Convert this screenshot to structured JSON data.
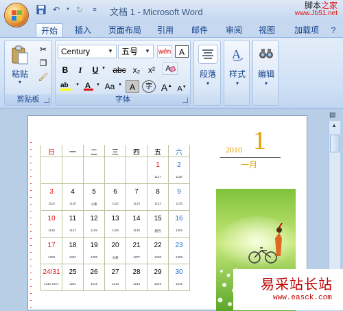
{
  "window": {
    "title": "文档 1 - Microsoft Word"
  },
  "brand": {
    "line1_a": "脚本",
    "line1_b": "之家",
    "line2": "www.Jb51.net"
  },
  "tabs": [
    "开始",
    "插入",
    "页面布局",
    "引用",
    "邮件",
    "审阅",
    "视图",
    "加载项"
  ],
  "active_tab": "开始",
  "ribbon": {
    "clipboard": {
      "paste_label": "粘贴",
      "group_label": "剪贴板"
    },
    "font": {
      "font_name": "Century",
      "font_size": "五号",
      "group_label": "字体",
      "wen": "wén",
      "A": "A",
      "B": "B",
      "I": "I",
      "U": "U",
      "abc": "abc",
      "sub": "x₂",
      "sup": "x²",
      "aa": "Aa",
      "grow": "A",
      "shrink": "A",
      "zi": "字"
    },
    "paragraph": {
      "label": "段落"
    },
    "styles": {
      "label": "样式"
    },
    "editing": {
      "label": "编辑"
    }
  },
  "calendar": {
    "year": "2010",
    "month_number": "1",
    "month_label": "一月",
    "weekdays": [
      "日",
      "一",
      "二",
      "三",
      "四",
      "五",
      "六"
    ],
    "weeks": [
      [
        {
          "d": "",
          "l": ""
        },
        {
          "d": "",
          "l": ""
        },
        {
          "d": "",
          "l": ""
        },
        {
          "d": "",
          "l": ""
        },
        {
          "d": "",
          "l": ""
        },
        {
          "d": "1",
          "l": "1117"
        },
        {
          "d": "2",
          "l": "1118"
        }
      ],
      [
        {
          "d": "3",
          "l": "1119"
        },
        {
          "d": "4",
          "l": "1120"
        },
        {
          "d": "5",
          "l": "小寒"
        },
        {
          "d": "6",
          "l": "1122"
        },
        {
          "d": "7",
          "l": "1123"
        },
        {
          "d": "8",
          "l": "1124"
        },
        {
          "d": "9",
          "l": "1125"
        }
      ],
      [
        {
          "d": "10",
          "l": "1126"
        },
        {
          "d": "11",
          "l": "1127"
        },
        {
          "d": "12",
          "l": "1128"
        },
        {
          "d": "13",
          "l": "1129"
        },
        {
          "d": "14",
          "l": "1130"
        },
        {
          "d": "15",
          "l": "腊月"
        },
        {
          "d": "16",
          "l": "1202"
        }
      ],
      [
        {
          "d": "17",
          "l": "1203"
        },
        {
          "d": "18",
          "l": "1204"
        },
        {
          "d": "19",
          "l": "1205"
        },
        {
          "d": "20",
          "l": "大寒"
        },
        {
          "d": "21",
          "l": "1207"
        },
        {
          "d": "22",
          "l": "1208"
        },
        {
          "d": "23",
          "l": "1209"
        }
      ],
      [
        {
          "d": "24/31",
          "l": "1210 1217"
        },
        {
          "d": "25",
          "l": "1211"
        },
        {
          "d": "26",
          "l": "1212"
        },
        {
          "d": "27",
          "l": "1213"
        },
        {
          "d": "28",
          "l": "1214"
        },
        {
          "d": "29",
          "l": "1215"
        },
        {
          "d": "30",
          "l": "1216"
        }
      ]
    ]
  },
  "watermark": {
    "line1": "易采站长站",
    "line2": "www.easck.com"
  },
  "colors": {
    "accent_red": "#e01010",
    "weekend_blue": "#1f6fd0",
    "gold": "#e0a000"
  }
}
